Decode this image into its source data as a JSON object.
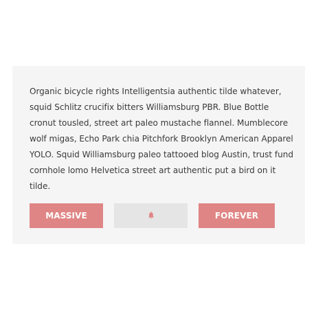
{
  "card": {
    "paragraph": "Organic bicycle rights Intelligentsia authentic tilde whatever, squid Schlitz crucifix bitters Williamsburg PBR. Blue Bottle cronut tousled, street art paleo mustache flannel. Mumblecore wolf migas, Echo Park chia Pitchfork Brooklyn American Apparel YOLO. Squid Williamsburg paleo tattooed blog Austin, trust fund cornhole lomo Helvetica street art authentic put a bird on it tilde."
  },
  "buttons": {
    "massive_label": "MASSIVE",
    "middle_icon": "bell-icon",
    "forever_label": "FOREVER"
  },
  "colors": {
    "accent": "#e08585",
    "card_background": "#f5f5f5",
    "neutral_button": "#e5e5e5",
    "text": "#3a3a3a"
  }
}
